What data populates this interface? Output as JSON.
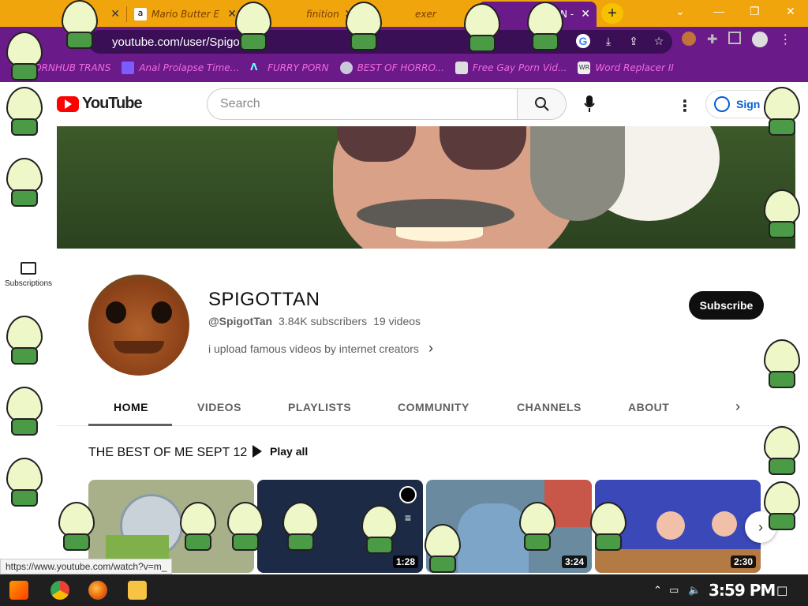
{
  "browser": {
    "tabs": [
      {
        "label": "",
        "favicon": "peridot-icon"
      },
      {
        "label": "Mario Butter E",
        "favicon": "amazon-icon"
      },
      {
        "label": "finition",
        "favicon": "peridot-icon"
      },
      {
        "label": "exer",
        "favicon": "peridot-icon"
      },
      {
        "label": "N -",
        "favicon": "youtube-icon",
        "active": true
      }
    ],
    "url_host": "youtube.com",
    "url_path": "/user/Spigo",
    "bookmarks": [
      {
        "label": "PORNHUB TRANS",
        "icon": "globe-icon"
      },
      {
        "label": "Anal Prolapse Time...",
        "icon": "bookmark-icon"
      },
      {
        "label": "FURRY PORN",
        "icon": "lambda-icon"
      },
      {
        "label": "BEST OF HORRO...",
        "icon": "globe-icon"
      },
      {
        "label": "Free Gay Porn Vid...",
        "icon": "puzzle-icon"
      },
      {
        "label": "Word Replacer II",
        "icon": "wr-icon"
      }
    ]
  },
  "youtube": {
    "logo_text": "YouTube",
    "search_placeholder": "Search",
    "signin_label": "Sign",
    "rail": [
      {
        "label": "Subscriptions",
        "icon": "subscriptions-icon"
      }
    ],
    "channel": {
      "name": "SPIGOTTAN",
      "handle": "@SpigotTan",
      "subscribers": "3.84K subscribers",
      "videos": "19 videos",
      "description": "i upload famous videos by internet creators",
      "subscribe_label": "Subscribe"
    },
    "tabs": [
      "HOME",
      "VIDEOS",
      "PLAYLISTS",
      "COMMUNITY",
      "CHANNELS",
      "ABOUT"
    ],
    "active_tab": "HOME",
    "shelf": {
      "title": "THE BEST OF ME SEPT 12",
      "play_all": "Play all",
      "videos": [
        {
          "duration": "",
          "color": "#a8b08a"
        },
        {
          "duration": "1:28",
          "color": "#1c2a45"
        },
        {
          "duration": "3:24",
          "color": "#6a8aa0"
        },
        {
          "duration": "2:30",
          "color": "#3a48b8"
        }
      ]
    }
  },
  "status_url": "https://www.youtube.com/watch?v=m_",
  "taskbar": {
    "clock": "3:59 PM",
    "apps": [
      "start-icon",
      "chrome-icon",
      "firefox-icon",
      "file-explorer-icon"
    ]
  }
}
